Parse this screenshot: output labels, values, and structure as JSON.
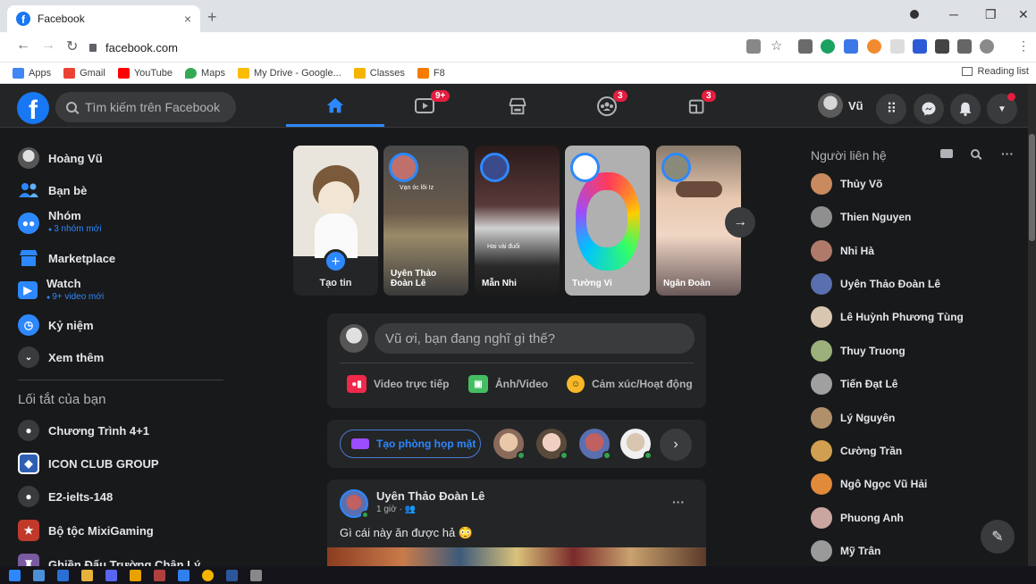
{
  "browser": {
    "tab_title": "Facebook",
    "tab_close": "×",
    "new_tab": "+",
    "url": "facebook.com",
    "bookmarks": [
      {
        "label": "Apps",
        "color": "#4285f4"
      },
      {
        "label": "Gmail",
        "color": "#ea4335"
      },
      {
        "label": "YouTube",
        "color": "#ff0000"
      },
      {
        "label": "Maps",
        "color": "#34a853"
      },
      {
        "label": "My Drive - Google...",
        "color": "#fbbc04"
      },
      {
        "label": "Classes",
        "color": "#f4b400"
      },
      {
        "label": "F8",
        "color": "#f57c00"
      }
    ],
    "reading_list": "Reading list"
  },
  "header": {
    "logo": "f",
    "search_placeholder": "Tìm kiếm trên Facebook",
    "badges": {
      "watch": "9+",
      "groups": "3",
      "gaming": "3"
    },
    "profile_name": "Vũ"
  },
  "left_sidebar": {
    "items": [
      {
        "label": "Hoàng Vũ",
        "sub": ""
      },
      {
        "label": "Bạn bè",
        "sub": ""
      },
      {
        "label": "Nhóm",
        "sub": "3 nhóm mới"
      },
      {
        "label": "Marketplace",
        "sub": ""
      },
      {
        "label": "Watch",
        "sub": "9+ video mới"
      },
      {
        "label": "Kỷ niệm",
        "sub": ""
      },
      {
        "label": "Xem thêm",
        "sub": ""
      }
    ],
    "shortcuts_title": "Lối tắt của bạn",
    "shortcuts": [
      {
        "label": "Chương Trình 4+1"
      },
      {
        "label": "ICON CLUB GROUP"
      },
      {
        "label": "E2-ielts-148"
      },
      {
        "label": "Bộ tộc MixiGaming"
      },
      {
        "label": "Ghiền Đấu Trường Chân Lý"
      }
    ]
  },
  "stories": {
    "create_label": "Tạo tin",
    "items": [
      {
        "name": "Uyên Thảo Đoàn Lê",
        "caption": "Vạn óc lôi Iz"
      },
      {
        "name": "Mẫn Nhi",
        "caption": "Hai vài đuối"
      },
      {
        "name": "Tường Vi",
        "caption": ""
      },
      {
        "name": "Ngân Đoàn",
        "caption": ""
      }
    ]
  },
  "composer": {
    "placeholder": "Vũ ơi, bạn đang nghĩ gì thế?",
    "live_label": "Video trực tiếp",
    "photo_label": "Ảnh/Video",
    "feeling_label": "Cảm xúc/Hoạt động"
  },
  "rooms": {
    "create_label": "Tạo phòng họp mặt"
  },
  "post": {
    "author": "Uyên Thảo Đoàn Lê",
    "time": "1 giờ · ",
    "text": "Gì cái này ăn được hả 😳",
    "more": "···"
  },
  "contacts": {
    "title": "Người liên hệ",
    "more": "···",
    "items": [
      {
        "name": "Thủy Võ",
        "color": "#c98a5e"
      },
      {
        "name": "Thien Nguyen",
        "color": "#8f8f8f"
      },
      {
        "name": "Nhi Hà",
        "color": "#b07a6a"
      },
      {
        "name": "Uyên Thảo Đoàn Lê",
        "color": "#5a6fb0"
      },
      {
        "name": "Lê Huỳnh Phương Tùng",
        "color": "#d8c6b0"
      },
      {
        "name": "Thuy Truong",
        "color": "#9bb07a"
      },
      {
        "name": "Tiến Đạt Lê",
        "color": "#a0a0a0"
      },
      {
        "name": "Lý Nguyên",
        "color": "#b0906a"
      },
      {
        "name": "Cường Trần",
        "color": "#d0a050"
      },
      {
        "name": "Ngô Ngọc Vũ Hải",
        "color": "#e08a3a"
      },
      {
        "name": "Phuong Anh",
        "color": "#c9a7a0"
      },
      {
        "name": "Mỹ Trân",
        "color": "#9a9a9a"
      }
    ]
  }
}
